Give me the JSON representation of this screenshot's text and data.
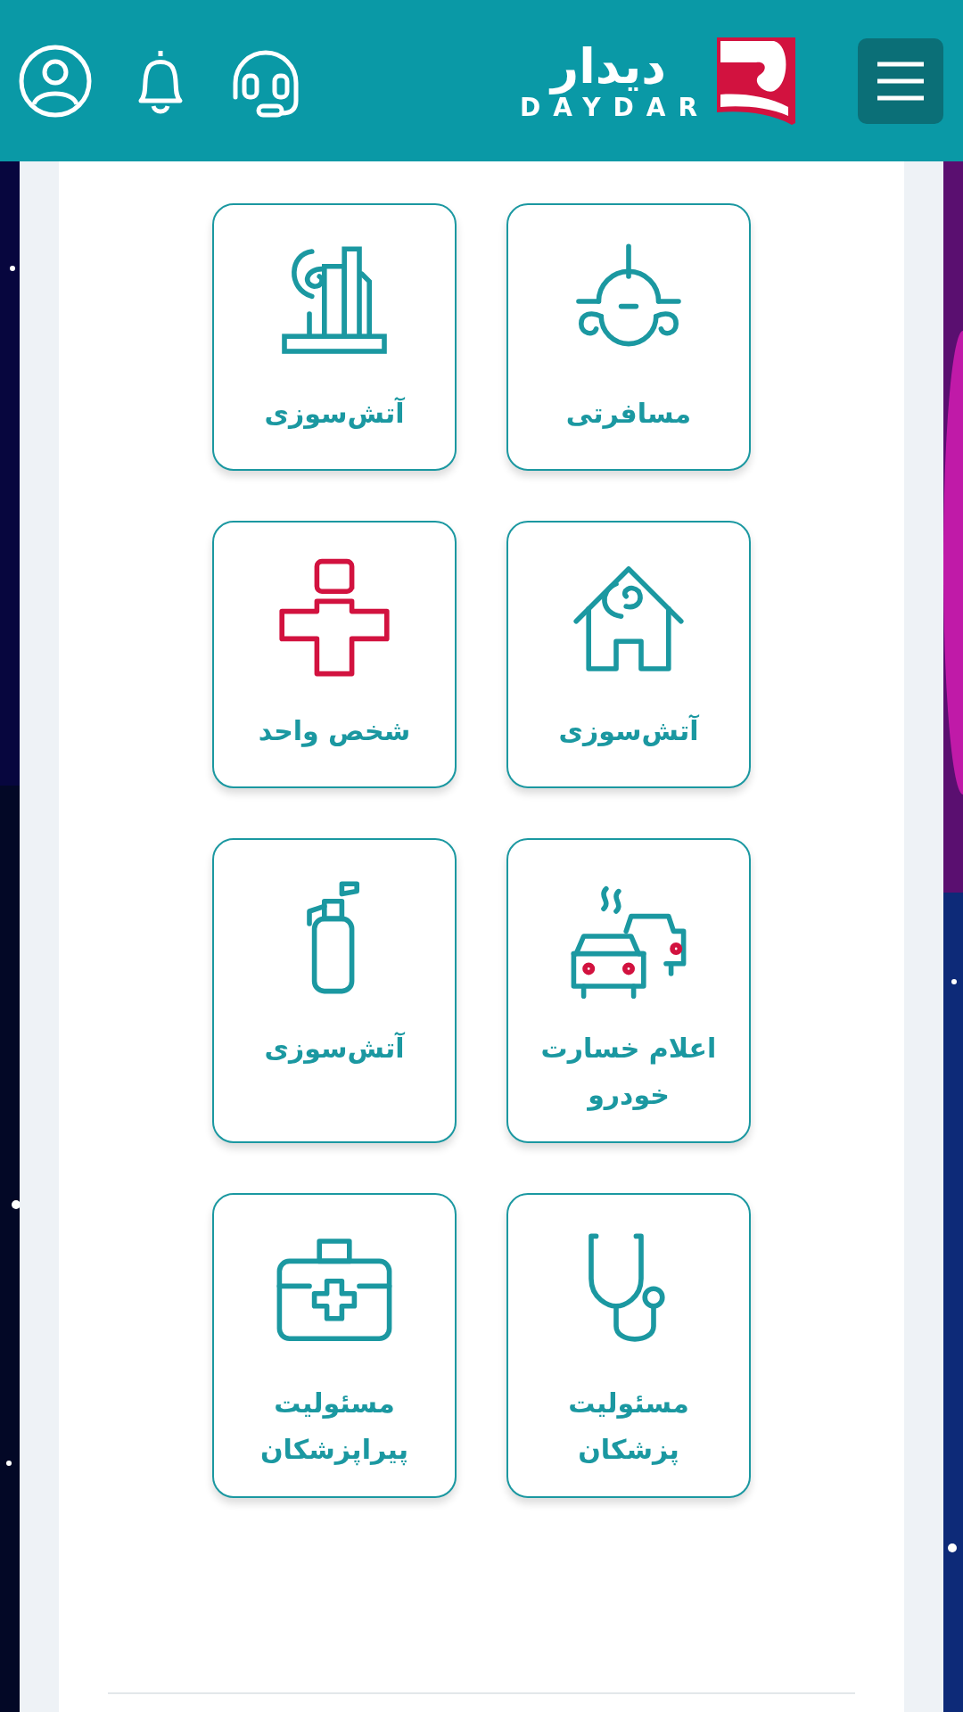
{
  "header": {
    "logo_fa": "دیدار",
    "logo_en": "DAYDAR"
  },
  "cards": [
    {
      "label": "مسافرتی"
    },
    {
      "label": "آتش‌سوزی"
    },
    {
      "label": "آتش‌سوزی"
    },
    {
      "label": "شخص واحد"
    },
    {
      "label": "اعلام خسارت خودرو"
    },
    {
      "label": "آتش‌سوزی"
    },
    {
      "label": "مسئولیت پزشکان"
    },
    {
      "label": "مسئولیت پیراپزشکان"
    }
  ]
}
